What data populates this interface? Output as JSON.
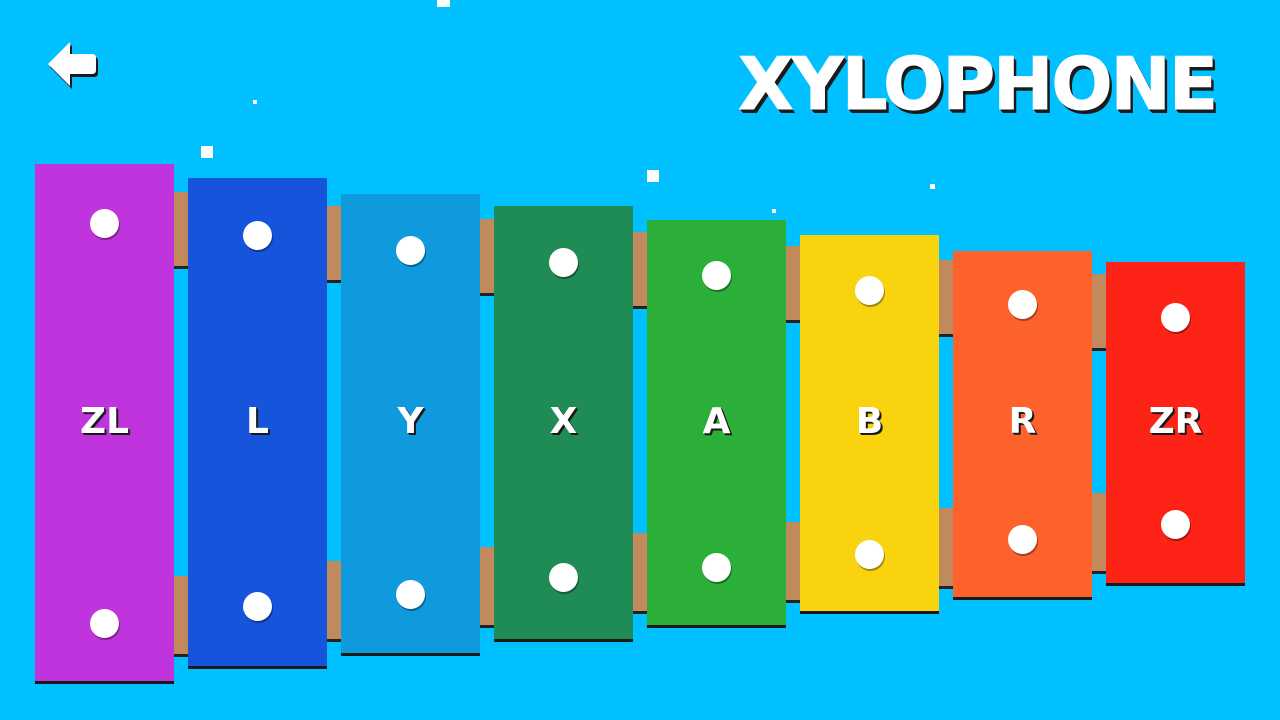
{
  "title": "XYLOPHONE",
  "back_button": {
    "icon": "back-arrow-icon"
  },
  "colors": {
    "background": "#00c0ff",
    "rail": "#c08a5c"
  },
  "bars": [
    {
      "label": "ZL",
      "color": "#c034de"
    },
    {
      "label": "L",
      "color": "#1654dc"
    },
    {
      "label": "Y",
      "color": "#0f9ade"
    },
    {
      "label": "X",
      "color": "#1f8c56"
    },
    {
      "label": "A",
      "color": "#2caf39"
    },
    {
      "label": "B",
      "color": "#f8d30e"
    },
    {
      "label": "R",
      "color": "#fd622d"
    },
    {
      "label": "ZR",
      "color": "#fd2316"
    }
  ]
}
